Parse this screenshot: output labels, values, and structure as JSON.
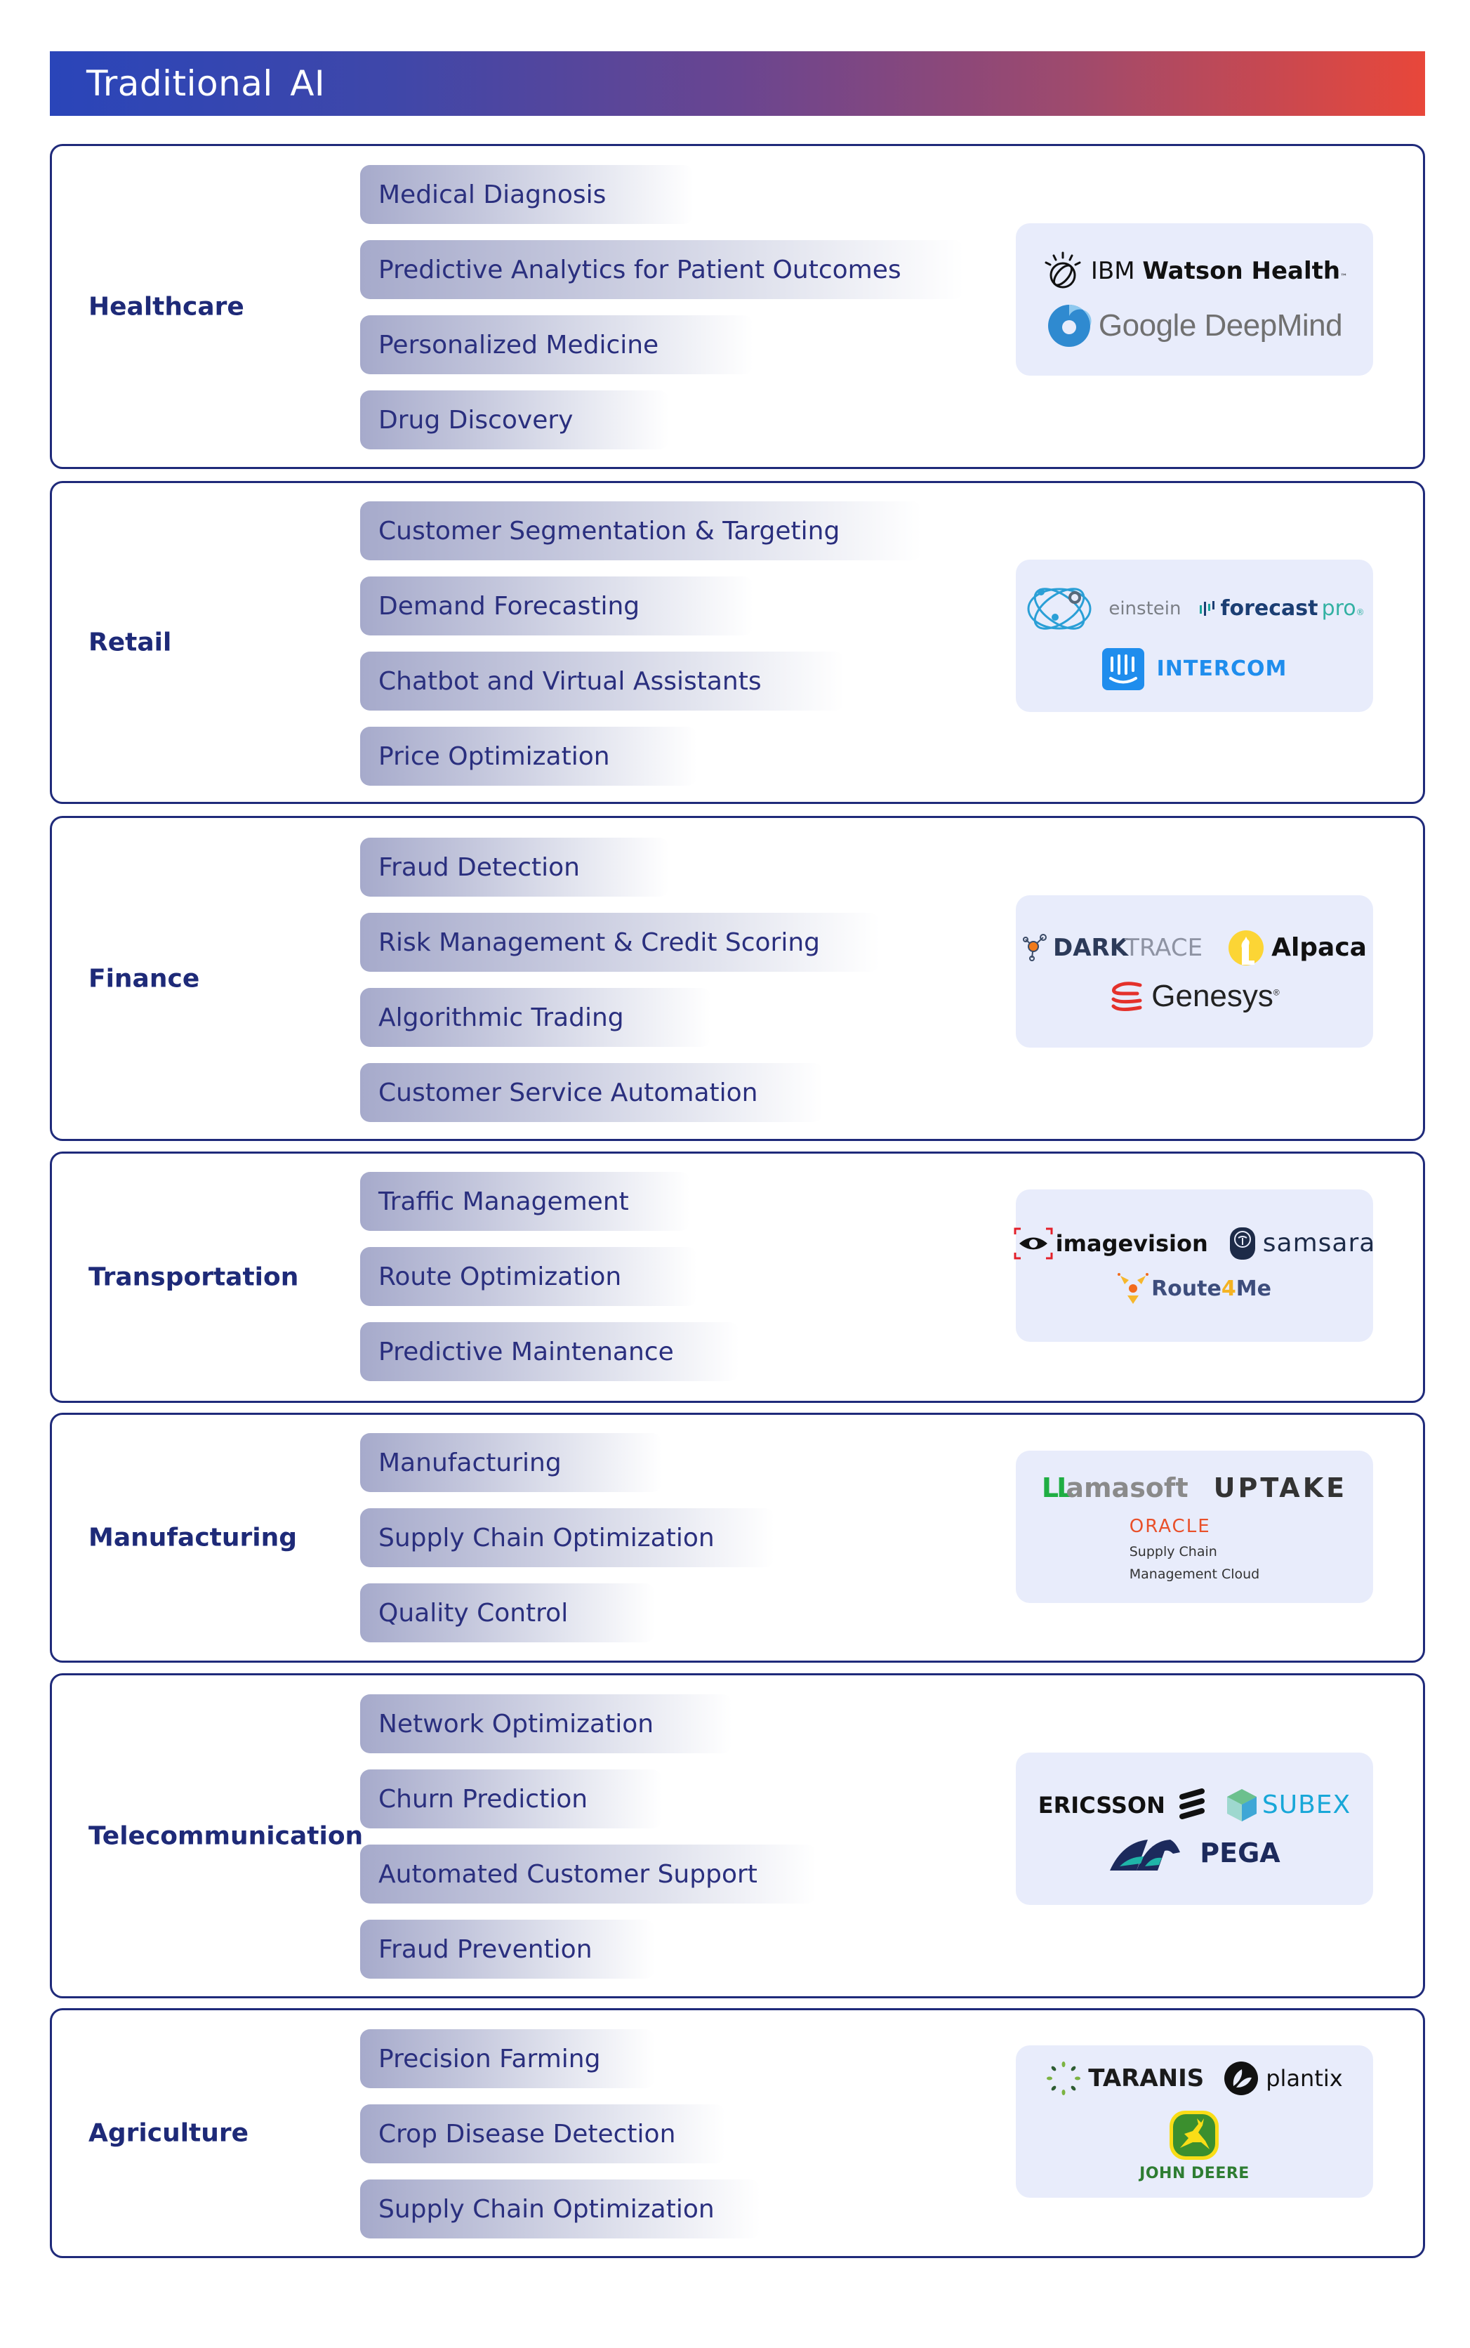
{
  "header": {
    "title": "Traditional AI"
  },
  "colors": {
    "header_gradient_start": "#2a45b9",
    "header_gradient_end": "#e8473a",
    "card_border": "#1f2a7a",
    "text_navy": "#1e2a78",
    "logo_panel_bg": "#e8ecfb"
  },
  "sectors": [
    {
      "name": "Healthcare",
      "use_cases": [
        "Medical Diagnosis",
        "Predictive Analytics for Patient Outcomes",
        "Personalized Medicine",
        "Drug Discovery"
      ],
      "companies": [
        "IBM Watson Health",
        "Google DeepMind"
      ]
    },
    {
      "name": "Retail",
      "use_cases": [
        "Customer Segmentation & Targeting",
        "Demand Forecasting",
        "Chatbot and Virtual Assistants",
        "Price Optimization"
      ],
      "companies": [
        "einstein",
        "forecast pro",
        "INTERCOM"
      ]
    },
    {
      "name": "Finance",
      "use_cases": [
        "Fraud Detection",
        "Risk Management & Credit Scoring",
        "Algorithmic Trading",
        "Customer Service Automation"
      ],
      "companies": [
        "DARKTRACE",
        "Alpaca",
        "Genesys"
      ]
    },
    {
      "name": "Transportation",
      "use_cases": [
        "Traffic Management",
        "Route Optimization",
        "Predictive Maintenance"
      ],
      "companies": [
        "imagevision",
        "samsara",
        "Route4Me"
      ]
    },
    {
      "name": "Manufacturing",
      "use_cases": [
        "Manufacturing",
        "Supply Chain Optimization",
        "Quality Control"
      ],
      "companies": [
        "LLamasoft",
        "UPTAKE",
        "ORACLE Supply Chain Management Cloud"
      ]
    },
    {
      "name": "Telecommunication",
      "use_cases": [
        "Network Optimization",
        "Churn Prediction",
        "Automated Customer Support",
        "Fraud Prevention"
      ],
      "companies": [
        "ERICSSON",
        "SUBEX",
        "PEGA"
      ]
    },
    {
      "name": "Agriculture",
      "use_cases": [
        "Precision Farming",
        "Crop Disease Detection",
        "Supply Chain Optimization"
      ],
      "companies": [
        "TARANIS",
        "plantix",
        "JOHN DEERE"
      ]
    }
  ],
  "logos": {
    "ibm": {
      "prefix": "IBM",
      "bold": "Watson Health",
      "tm": "™"
    },
    "deepmind": {
      "text": "Google DeepMind"
    },
    "einstein": {
      "text": "einstein"
    },
    "forecastpro": {
      "a": "forecast",
      "b": "pro",
      "mark": "®"
    },
    "intercom": {
      "text": "INTERCOM"
    },
    "darktrace": {
      "a": "DARK",
      "b": "TRACE"
    },
    "alpaca": {
      "text": "Alpaca"
    },
    "genesys": {
      "text": "Genesys",
      "mark": "®"
    },
    "imagevision": {
      "text": "imagevision"
    },
    "samsara": {
      "text": "samsara"
    },
    "route4me": {
      "a": "Route",
      "four": "4",
      "b": "Me"
    },
    "llamasoft": {
      "a": "LL",
      "b": "amasoft"
    },
    "uptake": {
      "text": "UPTAKE"
    },
    "oracle": {
      "text": "ORACLE",
      "line1": "Supply Chain",
      "line2": "Management Cloud"
    },
    "ericsson": {
      "text": "ERICSSON"
    },
    "subex": {
      "text": "SUBEX"
    },
    "pega": {
      "text": "PEGA"
    },
    "taranis": {
      "text": "TARANIS"
    },
    "plantix": {
      "text": "plantix"
    },
    "johndeere": {
      "text": "JOHN DEERE"
    }
  }
}
